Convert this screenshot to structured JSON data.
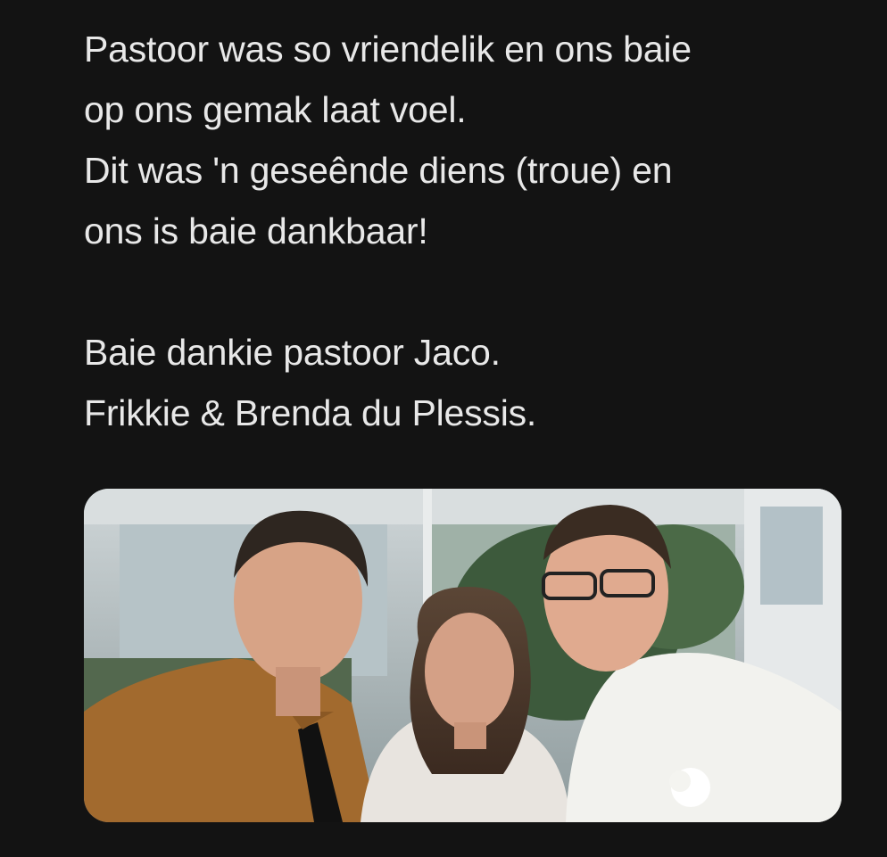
{
  "review": {
    "lines": [
      "Pastoor was so vriendelik en ons baie",
      "op ons gemak laat voel.",
      "Dit was 'n geseênde diens (troue) en",
      "ons is baie dankbaar!",
      "Baie dankie pastoor Jaco.",
      "Frikkie & Brenda du Plessis."
    ]
  },
  "photo": {
    "subject": "group selfie of three people indoors",
    "colors": {
      "background_window": "#b9c4c8",
      "foliage": "#3d5a3c",
      "left_shirt": "#a26a2e",
      "tie": "#111111",
      "middle_dress": "#e8e4df",
      "right_shirt": "#f2f2ee",
      "skin": "#d9a58a"
    }
  }
}
